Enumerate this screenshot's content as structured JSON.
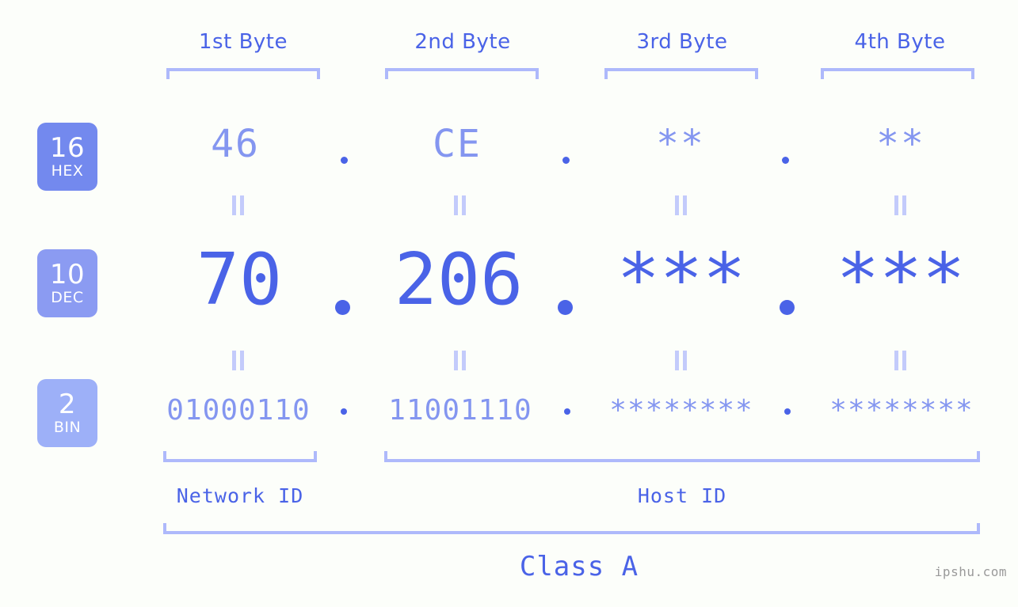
{
  "page": {
    "background_color": "#fcfefa",
    "accent_color": "#4a63e7",
    "muted_accent_color": "#8496f0",
    "bracket_color": "#aeb9fb",
    "watermark": "ipshu.com"
  },
  "byte_headers": [
    {
      "label": "1st Byte"
    },
    {
      "label": "2nd Byte"
    },
    {
      "label": "3rd Byte"
    },
    {
      "label": "4th Byte"
    }
  ],
  "bases": [
    {
      "num": "16",
      "abbr": "HEX",
      "color": "#7389ee"
    },
    {
      "num": "10",
      "abbr": "DEC",
      "color": "#8b9bf2"
    },
    {
      "num": "2",
      "abbr": "BIN",
      "color": "#9db0f8"
    }
  ],
  "rows": {
    "hex": {
      "values": [
        "46",
        "CE",
        "**",
        "**"
      ],
      "separator": "."
    },
    "dec": {
      "values": [
        "70",
        "206",
        "***",
        "***"
      ],
      "separator": "."
    },
    "bin": {
      "values": [
        "01000110",
        "11001110",
        "********",
        "********"
      ],
      "separator": "."
    }
  },
  "equals_marks": {
    "symbol": "||"
  },
  "id_sections": [
    {
      "label": "Network ID"
    },
    {
      "label": "Host ID"
    }
  ],
  "class_section": {
    "label": "Class A"
  }
}
